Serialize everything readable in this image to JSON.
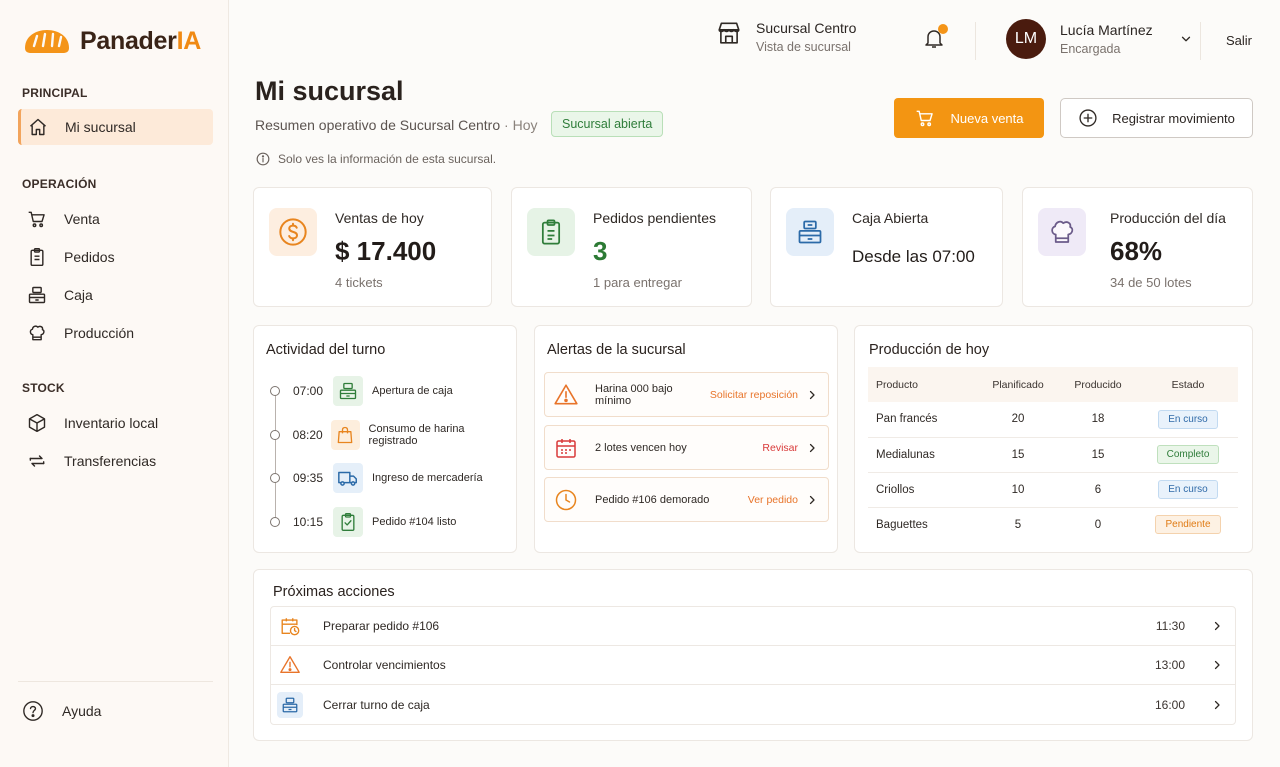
{
  "app": {
    "logo_main": "Panader",
    "logo_accent": "IA"
  },
  "sidebar": {
    "sections": [
      {
        "title": "PRINCIPAL"
      },
      {
        "title": "OPERACIÓN"
      },
      {
        "title": "STOCK"
      }
    ],
    "items": [
      {
        "label": "Mi sucursal",
        "icon": "home-icon"
      },
      {
        "label": "Venta",
        "icon": "cart-icon"
      },
      {
        "label": "Pedidos",
        "icon": "clipboard-icon"
      },
      {
        "label": "Caja",
        "icon": "cash-register-icon"
      },
      {
        "label": "Producción",
        "icon": "chef-hat-icon"
      },
      {
        "label": "Inventario local",
        "icon": "box-icon"
      },
      {
        "label": "Transferencias",
        "icon": "transfer-icon"
      }
    ],
    "help_label": "Ayuda"
  },
  "topbar": {
    "branch_name": "Sucursal Centro",
    "branch_sub": "Vista de sucursal",
    "user_initials": "LM",
    "user_name": "Lucía Martínez",
    "user_role": "Encargada",
    "logout_label": "Salir"
  },
  "header": {
    "title": "Mi sucursal",
    "subtitle": "Resumen operativo de Sucursal Centro",
    "subtitle_suffix": "· Hoy",
    "status_badge": "Sucursal abierta",
    "info_note": "Solo ves la información de esta sucursal.",
    "primary_button": "Nueva venta",
    "secondary_button": "Registrar movimiento"
  },
  "kpis": [
    {
      "label": "Ventas de hoy",
      "value": "$ 17.400",
      "sub": "4 tickets",
      "icon": "dollar-icon"
    },
    {
      "label": "Pedidos pendientes",
      "value": "3",
      "sub": "1 para entregar",
      "icon": "clipboard-icon"
    },
    {
      "label": "Caja Abierta",
      "value": "Desde las 07:00",
      "sub": "",
      "icon": "cash-register-icon"
    },
    {
      "label": "Producción del día",
      "value": "68%",
      "sub": "34 de 50 lotes",
      "icon": "chef-hat-icon"
    }
  ],
  "activity": {
    "title": "Actividad del turno",
    "items": [
      {
        "time": "07:00",
        "text": "Apertura de caja",
        "icon": "cash-register-icon"
      },
      {
        "time": "08:20",
        "text": "Consumo de harina registrado",
        "icon": "bag-icon"
      },
      {
        "time": "09:35",
        "text": "Ingreso de mercadería",
        "icon": "truck-icon"
      },
      {
        "time": "10:15",
        "text": "Pedido #104 listo",
        "icon": "clipboard-check-icon"
      }
    ]
  },
  "alerts": {
    "title": "Alertas de la sucursal",
    "items": [
      {
        "text": "Harina 000 bajo mínimo",
        "action": "Solicitar reposición",
        "icon": "warning-icon",
        "color": "#e8742a"
      },
      {
        "text": "2 lotes vencen hoy",
        "action": "Revisar",
        "icon": "calendar-icon",
        "color": "#d93a3a"
      },
      {
        "text": "Pedido #106 demorado",
        "action": "Ver pedido",
        "icon": "clock-icon",
        "color": "#e8742a"
      }
    ]
  },
  "production": {
    "title": "Producción de hoy",
    "columns": [
      "Producto",
      "Planificado",
      "Producido",
      "Estado"
    ],
    "rows": [
      {
        "product": "Pan francés",
        "planned": "20",
        "produced": "18",
        "status": "En curso"
      },
      {
        "product": "Medialunas",
        "planned": "15",
        "produced": "15",
        "status": "Completo"
      },
      {
        "product": "Criollos",
        "planned": "10",
        "produced": "6",
        "status": "En curso"
      },
      {
        "product": "Baguettes",
        "planned": "5",
        "produced": "0",
        "status": "Pendiente"
      }
    ]
  },
  "next_actions": {
    "title": "Próximas acciones",
    "items": [
      {
        "label": "Preparar pedido #106",
        "time": "11:30",
        "icon": "calendar-clock-icon"
      },
      {
        "label": "Controlar vencimientos",
        "time": "13:00",
        "icon": "warning-icon"
      },
      {
        "label": "Cerrar turno de caja",
        "time": "16:00",
        "icon": "cash-register-icon"
      }
    ]
  },
  "colors": {
    "accent": "#f39512",
    "brand_dark": "#3a2417",
    "success": "#2c7a34"
  }
}
